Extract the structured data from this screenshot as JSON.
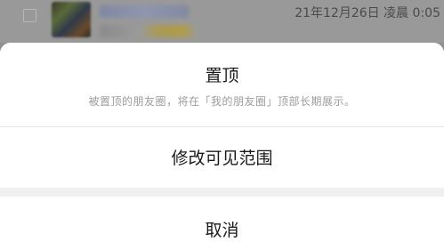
{
  "background": {
    "timestamp": "21年12月26日 凌晨 0:05"
  },
  "action_sheet": {
    "pin": {
      "title": "置顶",
      "subtitle": "被置顶的朋友圈，将在「我的朋友圈」顶部长期展示。"
    },
    "edit_visibility_label": "修改可见范围",
    "cancel_label": "取消"
  }
}
